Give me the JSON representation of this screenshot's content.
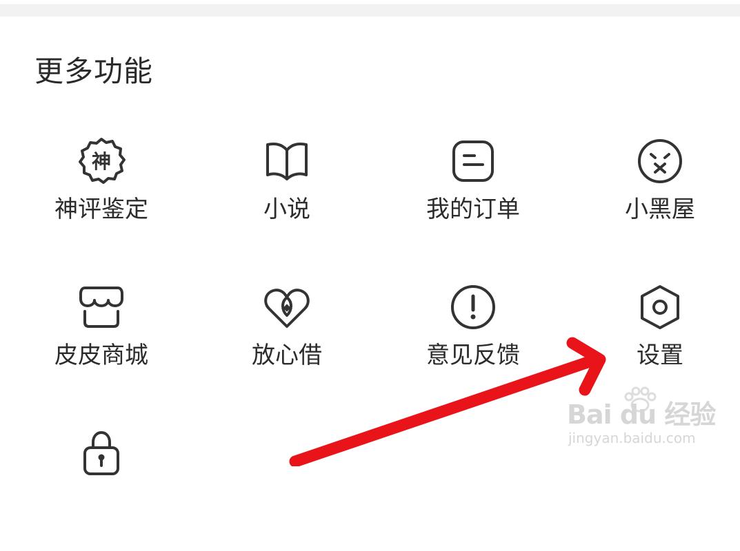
{
  "section": {
    "title": "更多功能"
  },
  "items": [
    {
      "label": "神评鉴定",
      "icon": "god-comment-badge-icon"
    },
    {
      "label": "小说",
      "icon": "book-icon"
    },
    {
      "label": "我的订单",
      "icon": "order-icon"
    },
    {
      "label": "小黑屋",
      "icon": "muted-face-icon"
    },
    {
      "label": "皮皮商城",
      "icon": "store-icon"
    },
    {
      "label": "放心借",
      "icon": "loan-hearts-icon"
    },
    {
      "label": "意见反馈",
      "icon": "exclamation-icon"
    },
    {
      "label": "设置",
      "icon": "settings-hexagon-icon"
    },
    {
      "label": "",
      "icon": "lock-icon"
    }
  ],
  "badge_glyph": "神",
  "annotation": {
    "arrow_color": "#e8141a",
    "arrow_target": "设置"
  },
  "watermark": {
    "brand": "Bai du 经验",
    "url": "jingyan.baidu.com"
  },
  "colors": {
    "icon_stroke": "#333333",
    "text": "#2c2c2c",
    "top_band": "#f2f2f2"
  }
}
